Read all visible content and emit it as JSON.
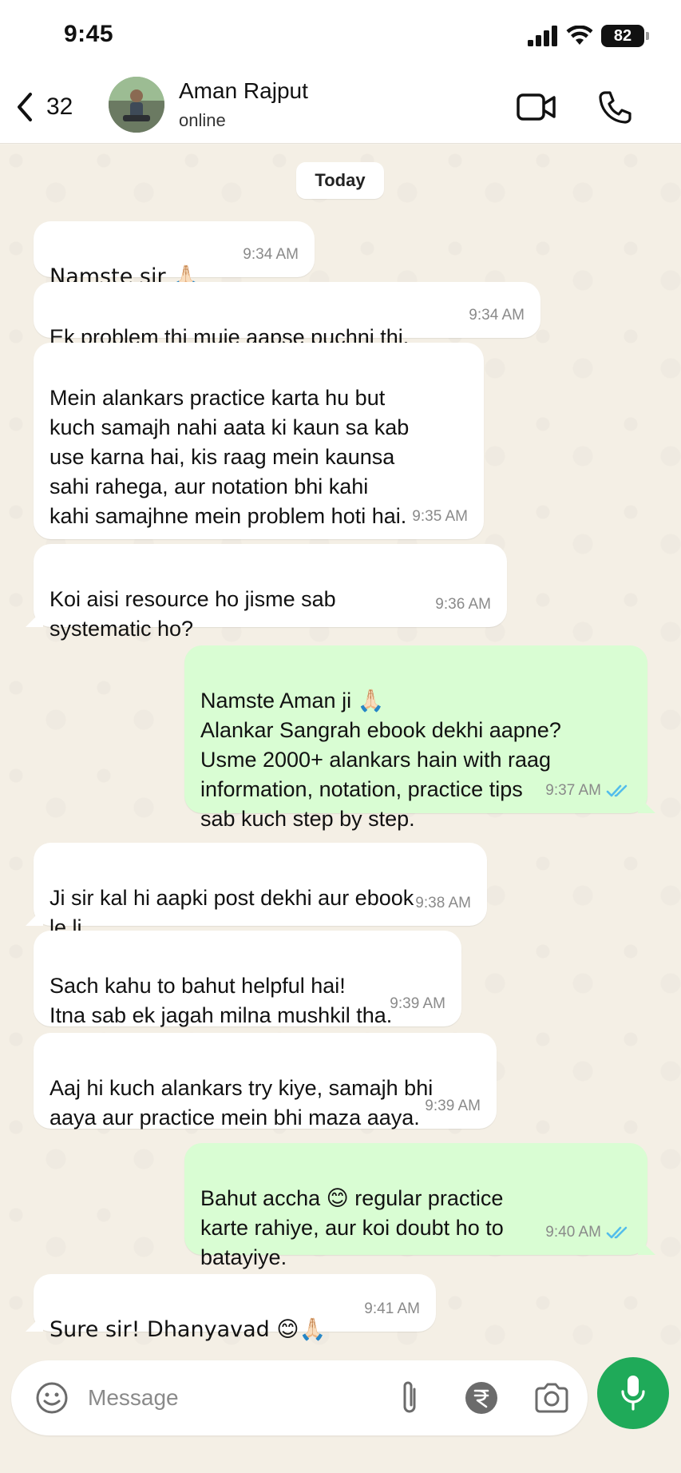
{
  "status_bar": {
    "time": "9:45",
    "battery": "82"
  },
  "header": {
    "back_count": "32",
    "contact_name": "Aman Rajput",
    "contact_status": "online"
  },
  "chat": {
    "date_label": "Today",
    "messages": [
      {
        "direction": "incoming",
        "text": "Namste sir 🙏🏻",
        "time": "9:34 AM"
      },
      {
        "direction": "incoming",
        "text": "Ek problem thi muje aapse puchni thi.",
        "time": "9:34 AM"
      },
      {
        "direction": "incoming",
        "text": "Mein alankars practice karta hu but\nkuch samajh nahi aata ki kaun sa kab\nuse karna hai, kis raag mein kaunsa\nsahi rahega, aur notation bhi kahi\nkahi samajhne mein problem hoti hai.",
        "time": "9:35 AM"
      },
      {
        "direction": "incoming",
        "text": "Koi aisi resource ho jisme sab\nsystematic ho?",
        "time": "9:36 AM"
      },
      {
        "direction": "outgoing",
        "text": "Namste Aman ji 🙏🏻\nAlankar Sangrah ebook dekhi aapne?\nUsme 2000+ alankars hain with raag\ninformation, notation, practice tips\nsab kuch step by step.",
        "time": "9:37 AM",
        "read": true
      },
      {
        "direction": "incoming",
        "text": "Ji sir kal hi aapki post dekhi aur ebook\nle li.",
        "time": "9:38 AM"
      },
      {
        "direction": "incoming",
        "text": "Sach kahu to bahut helpful hai!\nItna sab ek jagah milna mushkil tha.",
        "time": "9:39 AM"
      },
      {
        "direction": "incoming",
        "text": "Aaj hi kuch alankars try kiye, samajh bhi\naaya aur practice mein bhi maza aaya.",
        "time": "9:39 AM"
      },
      {
        "direction": "outgoing",
        "text": "Bahut accha 😊 regular practice\nkarte rahiye, aur koi doubt ho to\nbatayiye.",
        "time": "9:40 AM",
        "read": true
      },
      {
        "direction": "incoming",
        "text": "Sure sir! Dhanyavad 😊🙏🏻",
        "time": "9:41 AM"
      }
    ]
  },
  "composer": {
    "placeholder": "Message"
  },
  "colors": {
    "incoming_bubble": "#ffffff",
    "outgoing_bubble": "#d9fdd3",
    "read_ticks": "#53bdeb",
    "mic_button": "#1faa59",
    "chat_background": "#f4efe5"
  },
  "icons": {
    "header": [
      "chevron-left-icon",
      "video-call-icon",
      "phone-call-icon"
    ],
    "composer": [
      "emoji-icon",
      "attachment-icon",
      "rupee-payment-icon",
      "camera-icon",
      "microphone-icon"
    ],
    "status": [
      "cellular-signal-icon",
      "wifi-icon",
      "battery-icon"
    ]
  }
}
